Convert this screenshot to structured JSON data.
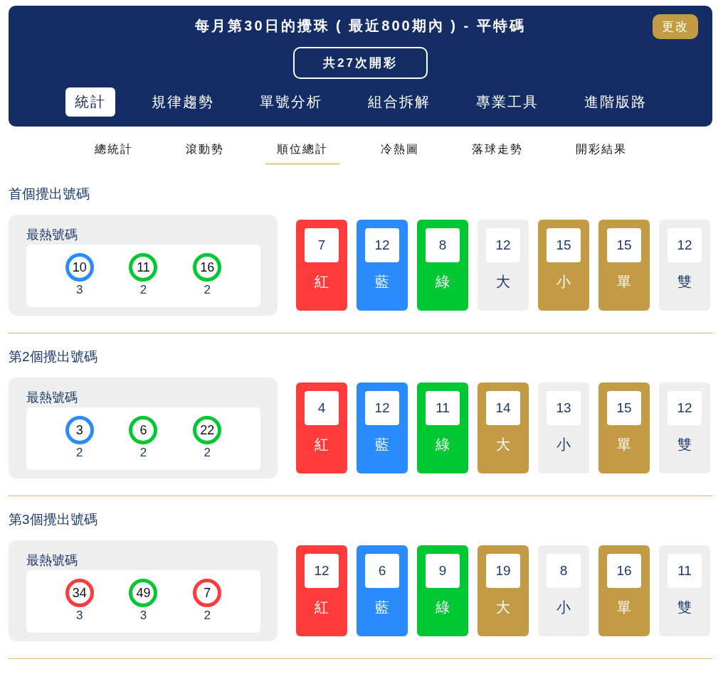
{
  "header": {
    "title": "每月第30日的攪珠 ( 最近800期內 ) - 平特碼",
    "change_button": "更改",
    "draw_count": "共27次開彩"
  },
  "tabs": [
    {
      "label": "統計",
      "selected": true
    },
    {
      "label": "規律趨勢",
      "selected": false
    },
    {
      "label": "單號分析",
      "selected": false
    },
    {
      "label": "組合拆解",
      "selected": false
    },
    {
      "label": "專業工具",
      "selected": false
    },
    {
      "label": "進階版路",
      "selected": false
    }
  ],
  "subtabs": [
    {
      "label": "總統計",
      "selected": false
    },
    {
      "label": "滾動勢",
      "selected": false
    },
    {
      "label": "順位總計",
      "selected": true
    },
    {
      "label": "冷熱圖",
      "selected": false
    },
    {
      "label": "落球走勢",
      "selected": false
    },
    {
      "label": "開彩結果",
      "selected": false
    }
  ],
  "sections": [
    {
      "title": "首個攪出號碼",
      "hot_title": "最熱號碼",
      "hot": [
        {
          "number": "10",
          "count": "3",
          "color": "#2a8bff"
        },
        {
          "number": "11",
          "count": "2",
          "color": "#00c832"
        },
        {
          "number": "16",
          "count": "2",
          "color": "#00c832"
        }
      ],
      "stats": [
        {
          "value": "7",
          "label": "紅",
          "color": "#ff3b3b"
        },
        {
          "value": "12",
          "label": "藍",
          "color": "#2a8bff"
        },
        {
          "value": "8",
          "label": "綠",
          "color": "#00c832"
        },
        {
          "value": "12",
          "label": "大",
          "color": "#eeeeee"
        },
        {
          "value": "15",
          "label": "小",
          "color": "#c49b45"
        },
        {
          "value": "15",
          "label": "單",
          "color": "#c49b45"
        },
        {
          "value": "12",
          "label": "雙",
          "color": "#eeeeee"
        }
      ]
    },
    {
      "title": "第2個攪出號碼",
      "hot_title": "最熱號碼",
      "hot": [
        {
          "number": "3",
          "count": "2",
          "color": "#2a8bff"
        },
        {
          "number": "6",
          "count": "2",
          "color": "#00c832"
        },
        {
          "number": "22",
          "count": "2",
          "color": "#00c832"
        }
      ],
      "stats": [
        {
          "value": "4",
          "label": "紅",
          "color": "#ff3b3b"
        },
        {
          "value": "12",
          "label": "藍",
          "color": "#2a8bff"
        },
        {
          "value": "11",
          "label": "綠",
          "color": "#00c832"
        },
        {
          "value": "14",
          "label": "大",
          "color": "#c49b45"
        },
        {
          "value": "13",
          "label": "小",
          "color": "#eeeeee"
        },
        {
          "value": "15",
          "label": "單",
          "color": "#c49b45"
        },
        {
          "value": "12",
          "label": "雙",
          "color": "#eeeeee"
        }
      ]
    },
    {
      "title": "第3個攪出號碼",
      "hot_title": "最熱號碼",
      "hot": [
        {
          "number": "34",
          "count": "3",
          "color": "#ff3b3b"
        },
        {
          "number": "49",
          "count": "3",
          "color": "#00c832"
        },
        {
          "number": "7",
          "count": "2",
          "color": "#ff3b3b"
        }
      ],
      "stats": [
        {
          "value": "12",
          "label": "紅",
          "color": "#ff3b3b"
        },
        {
          "value": "6",
          "label": "藍",
          "color": "#2a8bff"
        },
        {
          "value": "9",
          "label": "綠",
          "color": "#00c832"
        },
        {
          "value": "19",
          "label": "大",
          "color": "#c49b45"
        },
        {
          "value": "8",
          "label": "小",
          "color": "#eeeeee"
        },
        {
          "value": "16",
          "label": "單",
          "color": "#c49b45"
        },
        {
          "value": "11",
          "label": "雙",
          "color": "#eeeeee"
        }
      ]
    }
  ]
}
